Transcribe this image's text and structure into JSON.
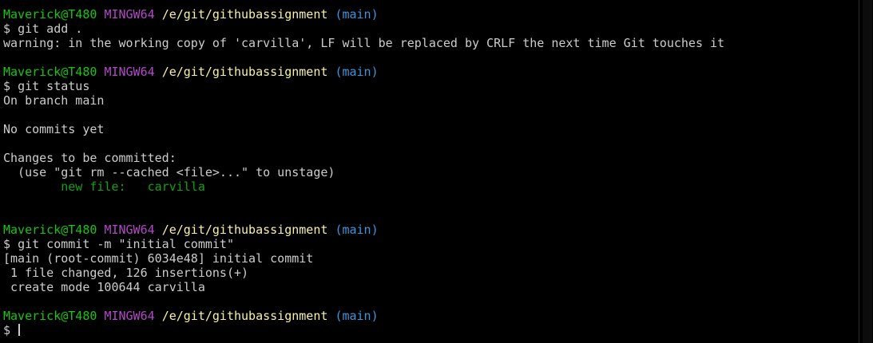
{
  "terminal": {
    "prompt": {
      "user_host": "Maverick@T480",
      "msystem": "MINGW64",
      "cwd": "/e/git/githubassignment",
      "branch": "(main)",
      "symbol": "$"
    },
    "lines": {
      "cmd_add": "git add .",
      "warning": "warning: in the working copy of 'carvilla', LF will be replaced by CRLF the next time Git touches it",
      "cmd_status": "git status",
      "on_branch": "On branch main",
      "no_commits": "No commits yet",
      "changes_header": "Changes to be committed:",
      "unstage_hint": "  (use \"git rm --cached <file>...\" to unstage)",
      "new_file": "        new file:   carvilla",
      "cmd_commit": "git commit -m \"initial commit\"",
      "commit_result": "[main (root-commit) 6034e48] initial commit",
      "files_changed": " 1 file changed, 126 insertions(+)",
      "create_mode": " create mode 100644 carvilla"
    }
  }
}
